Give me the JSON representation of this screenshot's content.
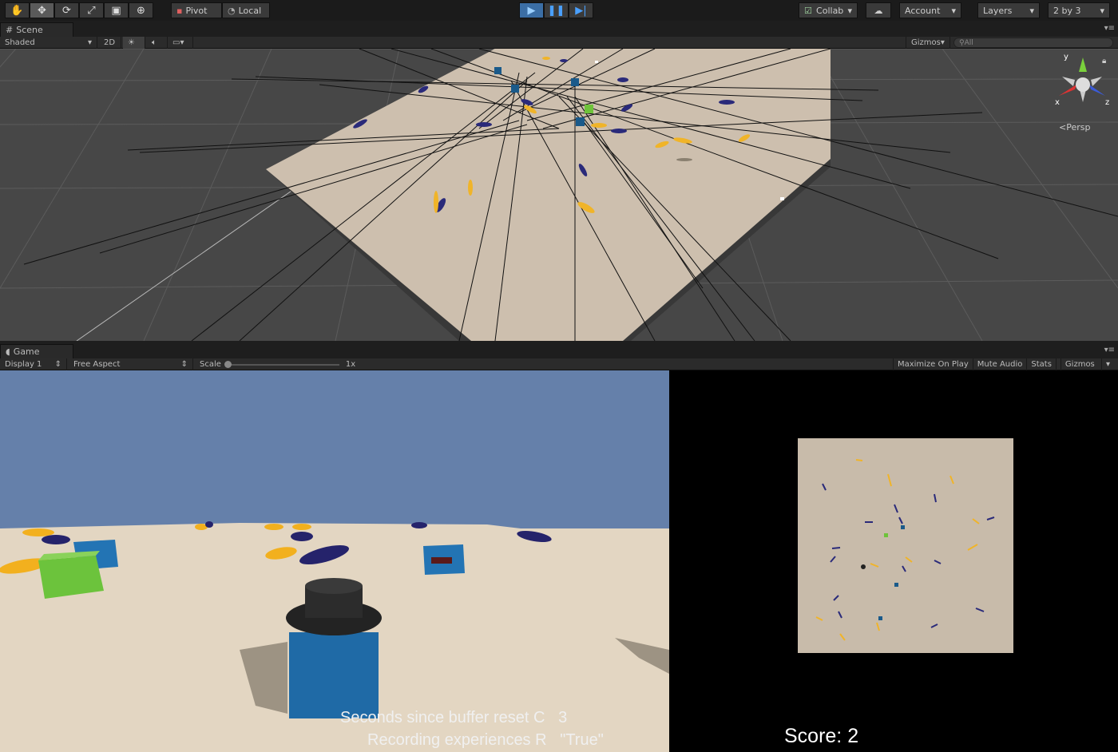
{
  "toolbar": {
    "transform_tools": [
      {
        "name": "hand-tool-icon",
        "glyph": "✋"
      },
      {
        "name": "move-tool-icon",
        "glyph": "✥"
      },
      {
        "name": "rotate-tool-icon",
        "glyph": "⟳"
      },
      {
        "name": "scale-tool-icon",
        "glyph": "⤢"
      },
      {
        "name": "rect-tool-icon",
        "glyph": "▣"
      },
      {
        "name": "transform-tool-icon",
        "glyph": "⊕"
      }
    ],
    "pivot_label": "Pivot",
    "local_label": "Local",
    "collab_label": "Collab",
    "account_label": "Account",
    "layers_label": "Layers",
    "layout_label": "2 by 3"
  },
  "scene": {
    "tab_label": "Scene",
    "shading_mode": "Shaded",
    "mode_2d": "2D",
    "gizmos_label": "Gizmos",
    "search_placeholder": "All",
    "persp_label": "Persp",
    "axis_x": "x",
    "axis_y": "y",
    "axis_z": "z"
  },
  "game": {
    "tab_label": "Game",
    "display_label": "Display 1",
    "aspect_label": "Free Aspect",
    "scale_label": "Scale",
    "scale_value": "1x",
    "maximize_label": "Maximize On Play",
    "mute_label": "Mute Audio",
    "stats_label": "Stats",
    "gizmos_label": "Gizmos",
    "hud_line1": "Seconds since buffer reset C   3",
    "hud_line2": "Recording experiences R   \"True\"",
    "score_text": "Score: 2"
  }
}
